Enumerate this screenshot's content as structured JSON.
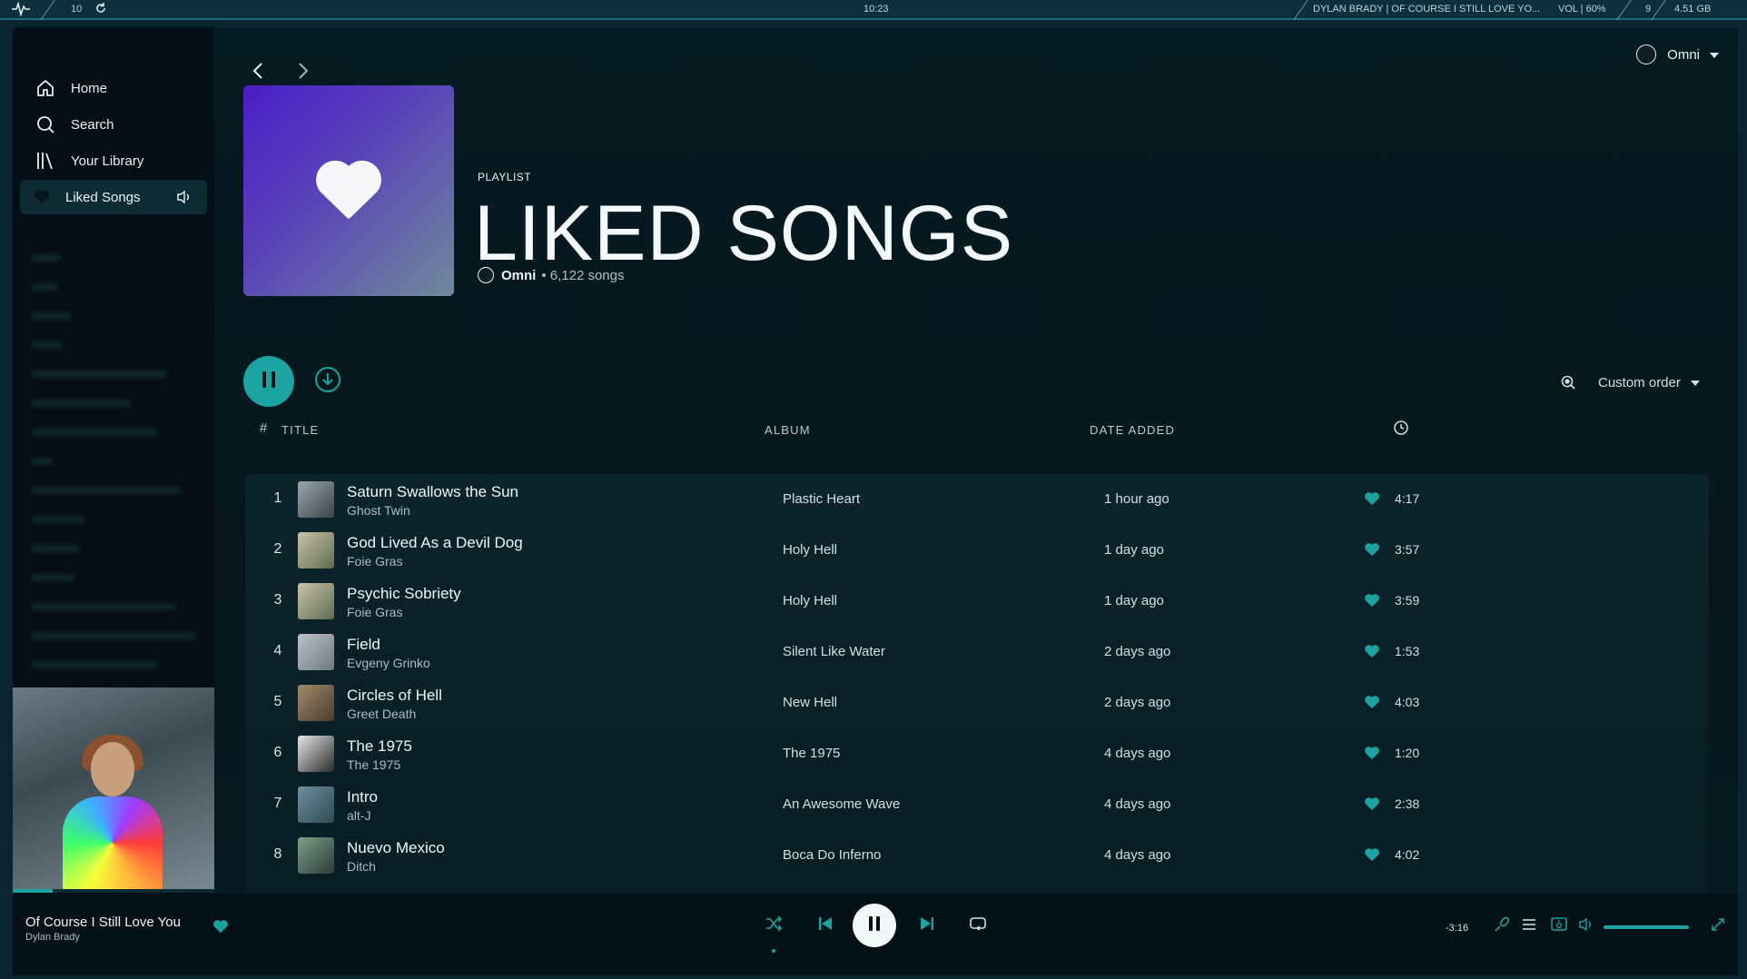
{
  "sysbar": {
    "workspace": "10",
    "clock": "10:23",
    "now_playing": "DYLAN BRADY | OF COURSE I STILL LOVE YO...",
    "volume": "VOL | 60%",
    "count": "9",
    "storage": "4.51 GB"
  },
  "sidebar": {
    "items": [
      {
        "label": "Home",
        "icon": "home-icon"
      },
      {
        "label": "Search",
        "icon": "search-icon"
      },
      {
        "label": "Your Library",
        "icon": "library-icon"
      },
      {
        "label": "Liked Songs",
        "icon": "heart-icon"
      }
    ]
  },
  "header": {
    "user_name": "Omni"
  },
  "playlist": {
    "type_label": "PLAYLIST",
    "title": "LIKED SONGS",
    "owner": "Omni",
    "song_count": "• 6,122 songs"
  },
  "actions": {
    "sort_label": "Custom order"
  },
  "table": {
    "headers": {
      "num": "#",
      "title": "TITLE",
      "album": "ALBUM",
      "date": "DATE ADDED"
    },
    "rows": [
      {
        "num": "1",
        "title": "Saturn Swallows the Sun",
        "artist": "Ghost Twin",
        "album": "Plastic Heart",
        "date": "1 hour ago",
        "duration": "4:17"
      },
      {
        "num": "2",
        "title": "God Lived As a Devil Dog",
        "artist": "Foie Gras",
        "album": "Holy Hell",
        "date": "1 day ago",
        "duration": "3:57"
      },
      {
        "num": "3",
        "title": "Psychic Sobriety",
        "artist": "Foie Gras",
        "album": "Holy Hell",
        "date": "1 day ago",
        "duration": "3:59"
      },
      {
        "num": "4",
        "title": "Field",
        "artist": "Evgeny Grinko",
        "album": "Silent Like Water",
        "date": "2 days ago",
        "duration": "1:53"
      },
      {
        "num": "5",
        "title": "Circles of Hell",
        "artist": "Greet Death",
        "album": "New Hell",
        "date": "2 days ago",
        "duration": "4:03"
      },
      {
        "num": "6",
        "title": "The 1975",
        "artist": "The 1975",
        "album": "The 1975",
        "date": "4 days ago",
        "duration": "1:20"
      },
      {
        "num": "7",
        "title": "Intro",
        "artist": "alt-J",
        "album": "An Awesome Wave",
        "date": "4 days ago",
        "duration": "2:38"
      },
      {
        "num": "8",
        "title": "Nuevo Mexico",
        "artist": "Ditch",
        "album": "Boca Do Inferno",
        "date": "4 days ago",
        "duration": "4:02"
      }
    ]
  },
  "player": {
    "track": "Of Course I Still Love You",
    "artist": "Dylan Brady",
    "remaining": "-3:16",
    "track_progress": 0.2,
    "volume_level": 0.6
  },
  "colors": {
    "accent": "#1aa3a0",
    "background": "#061a21"
  }
}
